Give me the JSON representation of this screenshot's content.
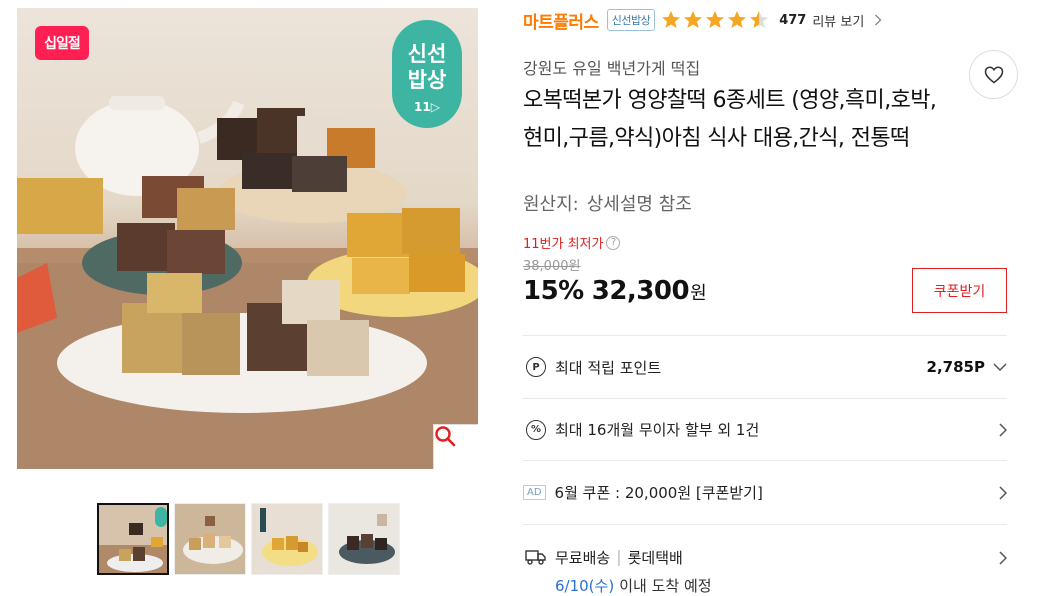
{
  "gallery": {
    "sale_badge": "십일절",
    "brand_badge": {
      "line1": "신선",
      "line2": "밥상",
      "line3": "11▷"
    },
    "zoom_icon": "search-icon",
    "thumbnail_count": 4
  },
  "seller": {
    "name": "마트플러스",
    "tag": "신선밥상",
    "rating": 4.5,
    "review_count": "477",
    "review_label": "리뷰 보기"
  },
  "product": {
    "shop": "강원도 유일 백년가게 떡집",
    "title": "오복떡본가 영양찰떡 6종세트 (영양,흑미,호박,현미,구름,약식)아침 식사 대용,간식, 전통떡",
    "origin_label": "원산지:",
    "origin_value": "상세설명 참조"
  },
  "price": {
    "lowest_label": "11번가 최저가",
    "original": "38,000원",
    "discount": "15%",
    "sale": "32,300",
    "unit": "원",
    "coupon_button": "쿠폰받기"
  },
  "benefits": {
    "points_label": "최대 적립 포인트",
    "points_value": "2,785P",
    "installment_label": "최대 16개월 무이자 할부 외 1건",
    "ad_tag": "AD",
    "ad_label": "6월 쿠폰 : 20,000원 [쿠폰받기]",
    "shipping_label": "무료배송",
    "carrier": "롯데택배",
    "arrival_date": "6/10(수)",
    "arrival_text": "이내 도착 예정"
  },
  "colors": {
    "seller": "#ff7a00",
    "price_red": "#e02020",
    "brand_badge": "#3eb5a3",
    "sale_badge": "#ff1f52",
    "star": "#f5a623",
    "date_blue": "#2a6fd6"
  }
}
